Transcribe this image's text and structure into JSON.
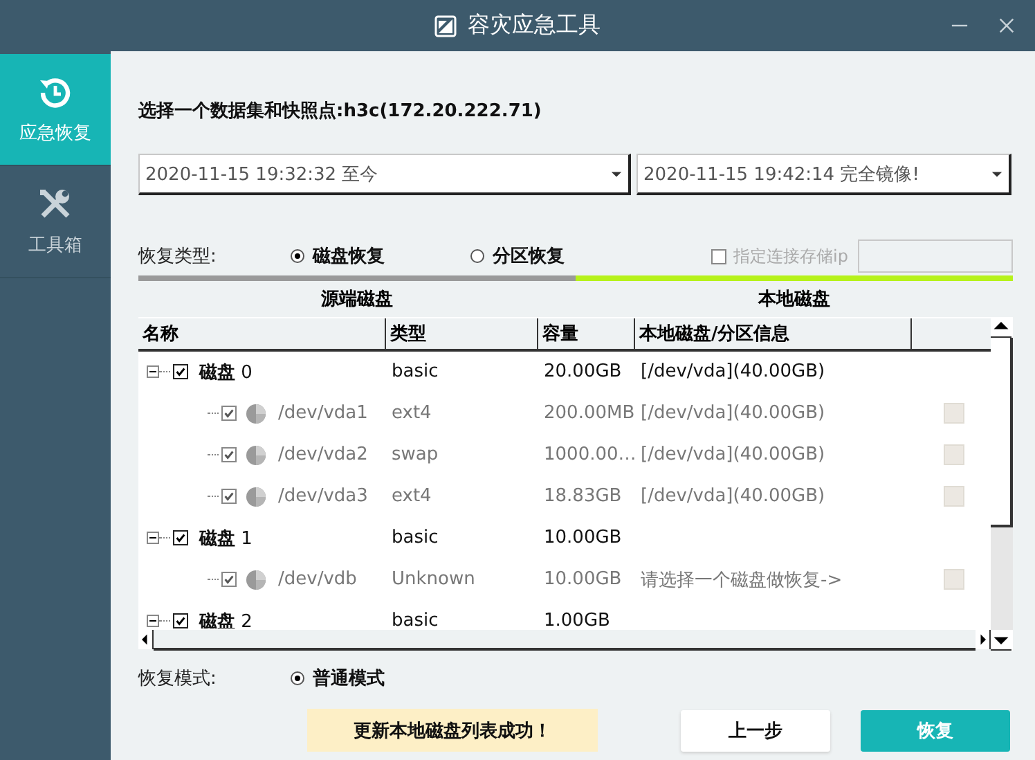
{
  "window": {
    "title": "容灾应急工具"
  },
  "sidebar": {
    "items": [
      {
        "label": "应急恢复",
        "kind": "restore",
        "selected": true
      },
      {
        "label": "工具箱",
        "kind": "tools",
        "selected": false
      }
    ]
  },
  "heading": "选择一个数据集和快照点:h3c(172.20.222.71)",
  "dropdowns": [
    {
      "value": "2020-11-15 19:32:32 至今"
    },
    {
      "value": "2020-11-15 19:42:14 完全镜像!"
    }
  ],
  "restore_type": {
    "label": "恢复类型:",
    "options": [
      {
        "label": "磁盘恢复",
        "selected": true
      },
      {
        "label": "分区恢复",
        "selected": false
      }
    ]
  },
  "storage_ip": {
    "label": "指定连接存储ip",
    "checked": false,
    "disabled": true
  },
  "sections": [
    {
      "label": "源端磁盘",
      "active": false
    },
    {
      "label": "本地磁盘",
      "active": true
    }
  ],
  "table": {
    "columns": [
      "名称",
      "类型",
      "容量",
      "本地磁盘/分区信息"
    ],
    "rows": [
      {
        "kind": "disk",
        "name": "**磁盘** 0",
        "checked": true,
        "expanded": true,
        "type": "basic",
        "capacity": "20.00GB",
        "local": "[/dev/vda](40.00GB)",
        "children": [
          {
            "kind": "partition",
            "name": "/dev/vda1",
            "checked": true,
            "type": "ext4",
            "capacity": "200.00MB",
            "local": "[/dev/vda](40.00GB)"
          },
          {
            "kind": "partition",
            "name": "/dev/vda2",
            "checked": true,
            "type": "swap",
            "capacity": "1000.00…",
            "local": "[/dev/vda](40.00GB)"
          },
          {
            "kind": "partition",
            "name": "/dev/vda3",
            "checked": true,
            "type": "ext4",
            "capacity": "18.83GB",
            "local": "[/dev/vda](40.00GB)"
          }
        ]
      },
      {
        "kind": "disk",
        "name": "**磁盘** 1",
        "checked": true,
        "expanded": true,
        "type": "basic",
        "capacity": "10.00GB",
        "children": [
          {
            "kind": "partition",
            "name": "/dev/vdb",
            "checked": true,
            "type": "Unknown",
            "capacity": "10.00GB",
            "local": "请选择一个磁盘做恢复->"
          }
        ]
      },
      {
        "kind": "disk",
        "name": "**磁盘** 2",
        "checked": true,
        "expanded": true,
        "type": "basic",
        "capacity": "1.00GB"
      }
    ]
  },
  "restore_mode": {
    "label": "恢复模式:",
    "options": [
      {
        "label": "普通模式",
        "selected": true
      }
    ]
  },
  "status_message": "更新本地磁盘列表成功！",
  "buttons": [
    {
      "label": "上一步",
      "kind": "secondary"
    },
    {
      "label": "恢复",
      "kind": "primary"
    }
  ]
}
